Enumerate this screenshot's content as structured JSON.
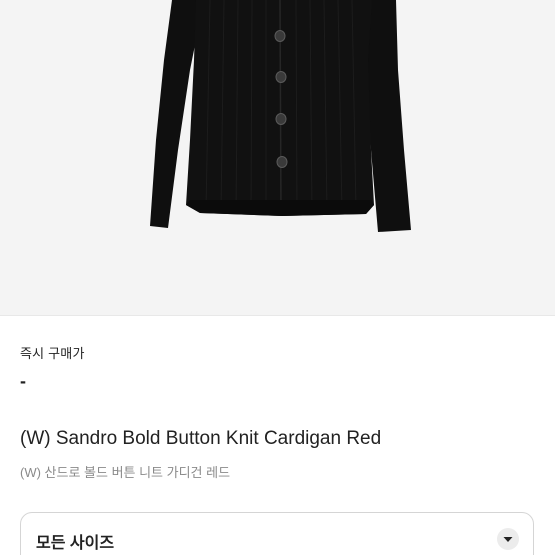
{
  "product": {
    "image_alt": "black knit cardigan",
    "title_en": "(W) Sandro Bold Button Knit Cardigan Red",
    "title_ko": "(W) 산드로 볼드 버튼 니트 가디건 레드"
  },
  "purchase": {
    "label": "즉시 구매가",
    "price": "-"
  },
  "size_selector": {
    "selected": "모든 사이즈",
    "icon": "chevron-down-icon"
  },
  "colors": {
    "background": "#f4f4f4",
    "garment": "#0f0f0f",
    "text": "#222222",
    "muted_text": "#8a8a8a",
    "border": "#d5d5d5"
  }
}
